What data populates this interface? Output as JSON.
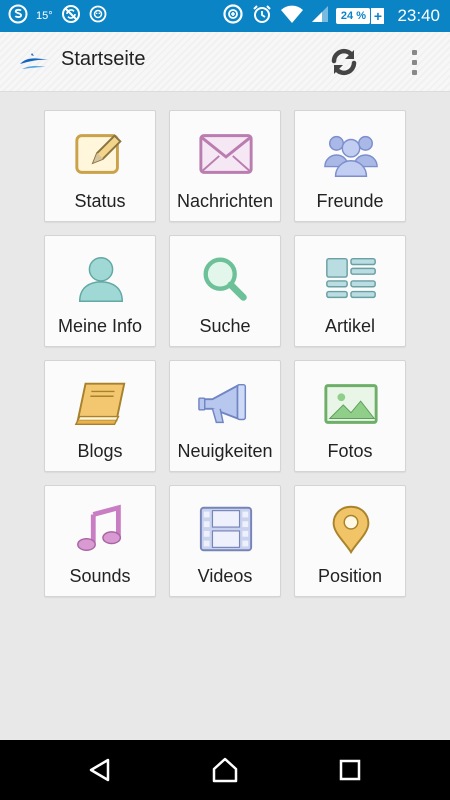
{
  "status_bar": {
    "temperature": "15°",
    "battery_percent": "24 %",
    "battery_plus": "+",
    "time": "23:40",
    "icons": [
      "app-s-icon",
      "weather-icon",
      "sync-off-icon",
      "smiley-icon",
      "data-saver-icon",
      "alarm-icon",
      "wifi-icon",
      "signal-icon",
      "battery-icon"
    ]
  },
  "action_bar": {
    "title": "Startseite",
    "logo_icon": "app-logo-icon",
    "refresh_icon": "refresh-icon",
    "overflow_icon": "overflow-menu-icon"
  },
  "tiles": [
    {
      "label": "Status",
      "icon": "status-edit-icon"
    },
    {
      "label": "Nachrichten",
      "icon": "envelope-icon"
    },
    {
      "label": "Freunde",
      "icon": "friends-icon"
    },
    {
      "label": "Meine Info",
      "icon": "user-icon"
    },
    {
      "label": "Suche",
      "icon": "search-icon"
    },
    {
      "label": "Artikel",
      "icon": "articles-icon"
    },
    {
      "label": "Blogs",
      "icon": "book-icon"
    },
    {
      "label": "Neuigkeiten",
      "icon": "megaphone-icon"
    },
    {
      "label": "Fotos",
      "icon": "photo-icon"
    },
    {
      "label": "Sounds",
      "icon": "music-note-icon"
    },
    {
      "label": "Videos",
      "icon": "film-icon"
    },
    {
      "label": "Position",
      "icon": "location-pin-icon"
    }
  ],
  "nav_bar": {
    "icons": [
      "back-icon",
      "home-icon",
      "recents-icon"
    ]
  },
  "colors": {
    "status_bar": "#0b84c6",
    "content_bg": "#e8e8e8",
    "tile_bg": "#fbfbfb",
    "nav_bar": "#000000"
  }
}
